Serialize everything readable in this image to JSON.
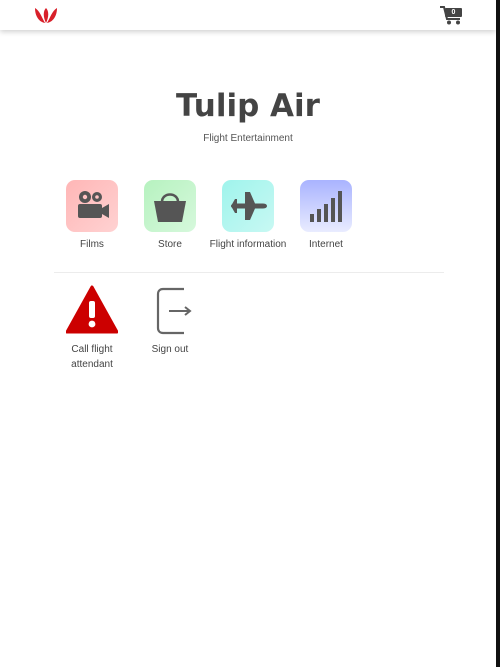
{
  "header": {
    "logo_icon": "tulip-icon",
    "cart_icon": "cart-icon",
    "cart_count": "0"
  },
  "brand": {
    "title": "Tulip Air",
    "subtitle": "Flight Entertainment"
  },
  "menu": {
    "films": {
      "label": "Films",
      "icon": "film-camera-icon"
    },
    "store": {
      "label": "Store",
      "icon": "shopping-basket-icon"
    },
    "flight_info": {
      "label": "Flight information",
      "icon": "airplane-icon"
    },
    "internet": {
      "label": "Internet",
      "icon": "signal-bars-icon"
    },
    "call_attendant": {
      "label": "Call flight attendant",
      "icon": "warning-icon"
    },
    "sign_out": {
      "label": "Sign out",
      "icon": "sign-out-icon"
    }
  },
  "colors": {
    "brand_red": "#d8202a",
    "warning_red": "#cc0000",
    "icon_gray": "#555555"
  }
}
